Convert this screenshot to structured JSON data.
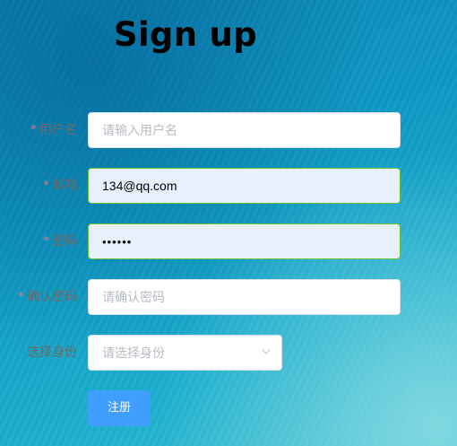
{
  "header": {
    "title": "Sign up"
  },
  "form": {
    "required_mark": "*",
    "username": {
      "label": "用户名",
      "placeholder": "请输入用户名",
      "value": ""
    },
    "email": {
      "label": "邮箱",
      "placeholder": "",
      "value": "134@qq.com"
    },
    "password": {
      "label": "密码",
      "placeholder": "",
      "value": "••••••"
    },
    "confirm_password": {
      "label": "确认密码",
      "placeholder": "请确认密码",
      "value": ""
    },
    "identity": {
      "label": "选择身份",
      "placeholder": "请选择身份",
      "icon": "chevron-down-icon"
    },
    "submit_label": "注册"
  },
  "colors": {
    "primary": "#409eff",
    "required": "#f56c6c",
    "valid_border": "#67c23a",
    "autofill_bg": "#e8f0fe"
  }
}
